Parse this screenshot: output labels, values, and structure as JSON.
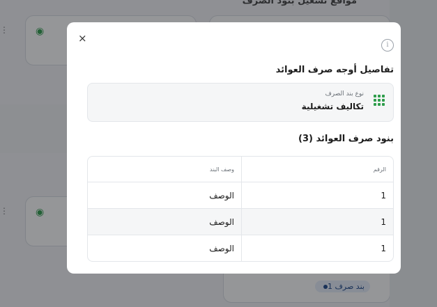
{
  "background": {
    "header_text": "مواقع تشغيل بنود الصرف",
    "badge_text": "1 بند صرف"
  },
  "modal": {
    "close_label": "×",
    "info_icon": "i",
    "title": "تفاصيل أوجه صرف العوائد",
    "type_card": {
      "label": "نوع بند الصرف",
      "value": "تكاليف تشغيلية"
    },
    "items_title": "بنود صرف العوائد (3)",
    "table": {
      "headers": [
        "الرقم",
        "وصف البند"
      ],
      "rows": [
        {
          "num": "1",
          "desc": "الوصف"
        },
        {
          "num": "1",
          "desc": "الوصف"
        },
        {
          "num": "1",
          "desc": "الوصف"
        }
      ]
    }
  }
}
